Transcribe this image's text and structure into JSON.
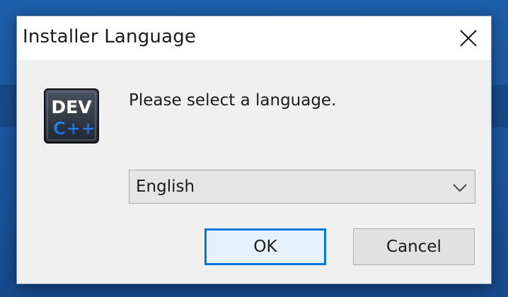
{
  "window": {
    "title": "Installer Language",
    "close_icon": "close-icon"
  },
  "app_icon": {
    "name": "devcpp-logo-icon",
    "line1": "DEV",
    "line2": "C++"
  },
  "content": {
    "message": "Please select a language."
  },
  "language_select": {
    "selected": "English",
    "icon": "chevron-down-icon"
  },
  "buttons": {
    "ok_label": "OK",
    "cancel_label": "Cancel"
  },
  "colors": {
    "desktop": "#1b56a0",
    "dialog_bg": "#f0f0f0",
    "titlebar_bg": "#ffffff",
    "focus_accent": "#0078d7"
  }
}
